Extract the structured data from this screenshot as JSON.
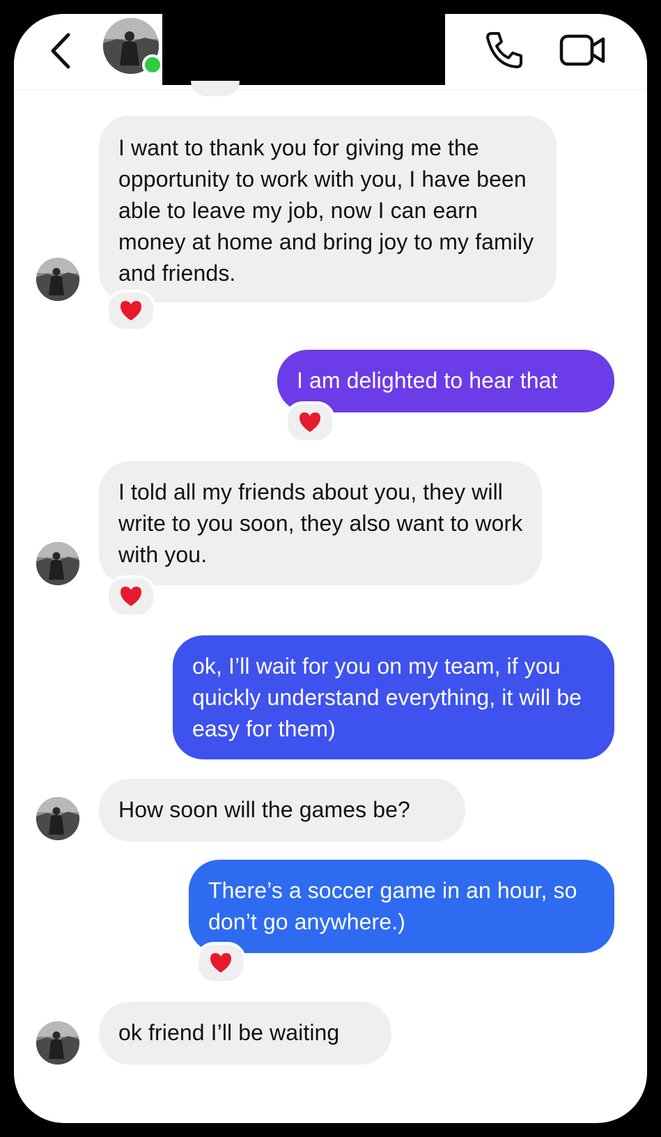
{
  "header": {
    "back_icon": "chevron-left-icon",
    "call_icon": "phone-icon",
    "video_icon": "video-camera-icon",
    "online_color": "#2ecc40"
  },
  "messages": [
    {
      "from": "them",
      "text": "I want to thank you for giving me the opportunity to work with you, I have been able to leave my job, now I can earn money at home and bring joy to my family and friends.",
      "reaction": "heart"
    },
    {
      "from": "me",
      "text": "I am delighted to hear that",
      "reaction": "heart"
    },
    {
      "from": "them",
      "text": "I told all my friends about you, they will write to you soon, they also want to work with you.",
      "reaction": "heart"
    },
    {
      "from": "me",
      "text": "ok, I’ll wait for you on my team, if you quickly understand everything, it will be easy for them)"
    },
    {
      "from": "them",
      "text": "How soon will the games be?"
    },
    {
      "from": "me",
      "text": "There’s a soccer game in an hour, so don’t go anywhere.)",
      "reaction": "heart"
    },
    {
      "from": "them",
      "text": "ok friend I’ll be waiting"
    }
  ],
  "colors": {
    "sent_bubble_top": "#6c3ce8",
    "sent_bubble_mid": "#3e52ee",
    "sent_bubble_bottom": "#2e6bf0",
    "received_bubble": "#efefef",
    "heart": "#e8192c"
  }
}
